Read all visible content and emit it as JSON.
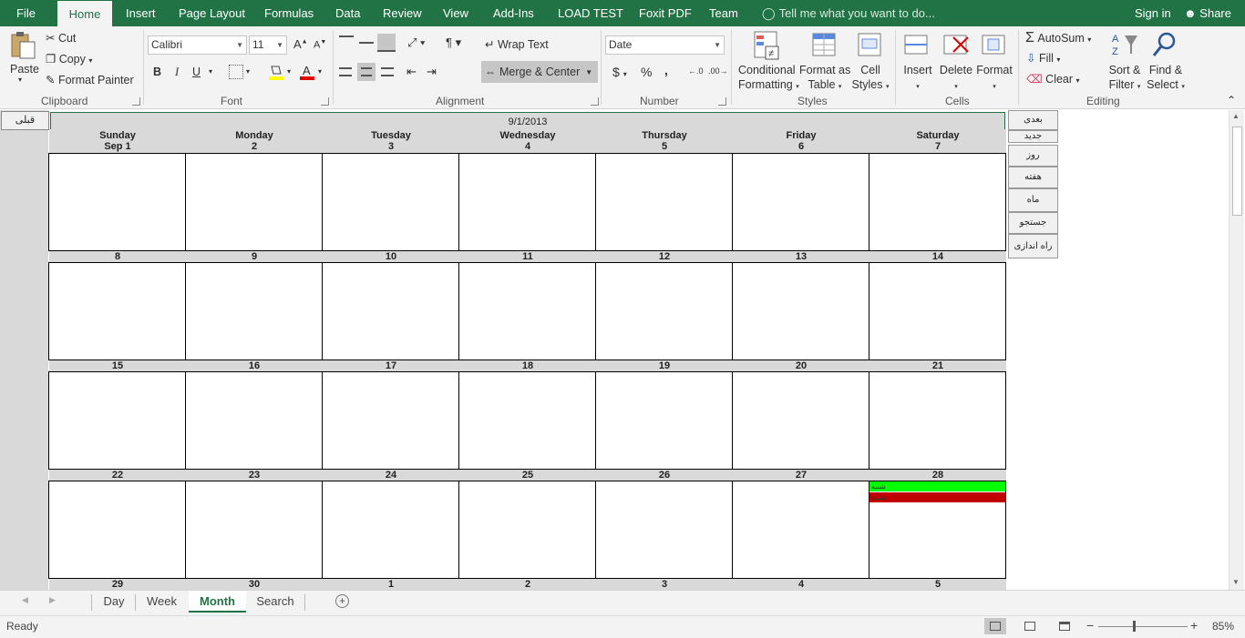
{
  "ribbon_tabs": [
    "File",
    "Home",
    "Insert",
    "Page Layout",
    "Formulas",
    "Data",
    "Review",
    "View",
    "Add-Ins",
    "LOAD TEST",
    "Foxit PDF",
    "Team"
  ],
  "tell_me": "Tell me what you want to do...",
  "sign_in": "Sign in",
  "share": "Share",
  "clipboard": {
    "paste": "Paste",
    "cut": "Cut",
    "copy": "Copy",
    "format_painter": "Format Painter",
    "label": "Clipboard"
  },
  "font": {
    "name": "Calibri",
    "size": "11",
    "label": "Font",
    "bold": "B",
    "italic": "I",
    "underline": "U",
    "grow": "A",
    "shrink": "A"
  },
  "alignment": {
    "wrap_text": "Wrap Text",
    "merge_center": "Merge & Center",
    "label": "Alignment"
  },
  "number": {
    "format": "Date",
    "currency": "$",
    "percent": "%",
    "comma": ",",
    "inc_dec": ".00",
    "dec_dec": ".0",
    "label": "Number"
  },
  "styles": {
    "conditional": "Conditional",
    "formatting": "Formatting",
    "format_as": "Format as",
    "table": "Table",
    "cell": "Cell",
    "styles_word": "Styles",
    "label": "Styles"
  },
  "cells": {
    "insert": "Insert",
    "delete": "Delete",
    "format": "Format",
    "label": "Cells"
  },
  "editing": {
    "autosum": "AutoSum",
    "fill": "Fill",
    "clear": "Clear",
    "sort": "Sort &",
    "filter": "Filter",
    "find": "Find &",
    "select": "Select",
    "label": "Editing"
  },
  "calendar": {
    "prev_button": "قبلی",
    "title": "9/1/2013",
    "days": [
      {
        "name": "Sunday",
        "date": "Sep 1"
      },
      {
        "name": "Monday",
        "date": "2"
      },
      {
        "name": "Tuesday",
        "date": "3"
      },
      {
        "name": "Wednesday",
        "date": "4"
      },
      {
        "name": "Thursday",
        "date": "5"
      },
      {
        "name": "Friday",
        "date": "6"
      },
      {
        "name": "Saturday",
        "date": "7"
      }
    ],
    "week_rows": [
      [
        "8",
        "9",
        "10",
        "11",
        "12",
        "13",
        "14"
      ],
      [
        "15",
        "16",
        "17",
        "18",
        "19",
        "20",
        "21"
      ],
      [
        "22",
        "23",
        "24",
        "25",
        "26",
        "27",
        "28"
      ],
      [
        "29",
        "30",
        "1",
        "2",
        "3",
        "4",
        "5"
      ]
    ],
    "events": [
      {
        "label": "شنبه",
        "color": "#00ff00"
      },
      {
        "label": "شنبه",
        "color": "#c00000"
      }
    ]
  },
  "side_buttons": [
    "بعدی",
    "جدید",
    "روز",
    "هفته",
    "ماه",
    "جستجو",
    "راه اندازی"
  ],
  "sheet_tabs": [
    "Day",
    "Week",
    "Month",
    "Search"
  ],
  "active_sheet": "Month",
  "status": {
    "ready": "Ready",
    "zoom": "85%"
  }
}
